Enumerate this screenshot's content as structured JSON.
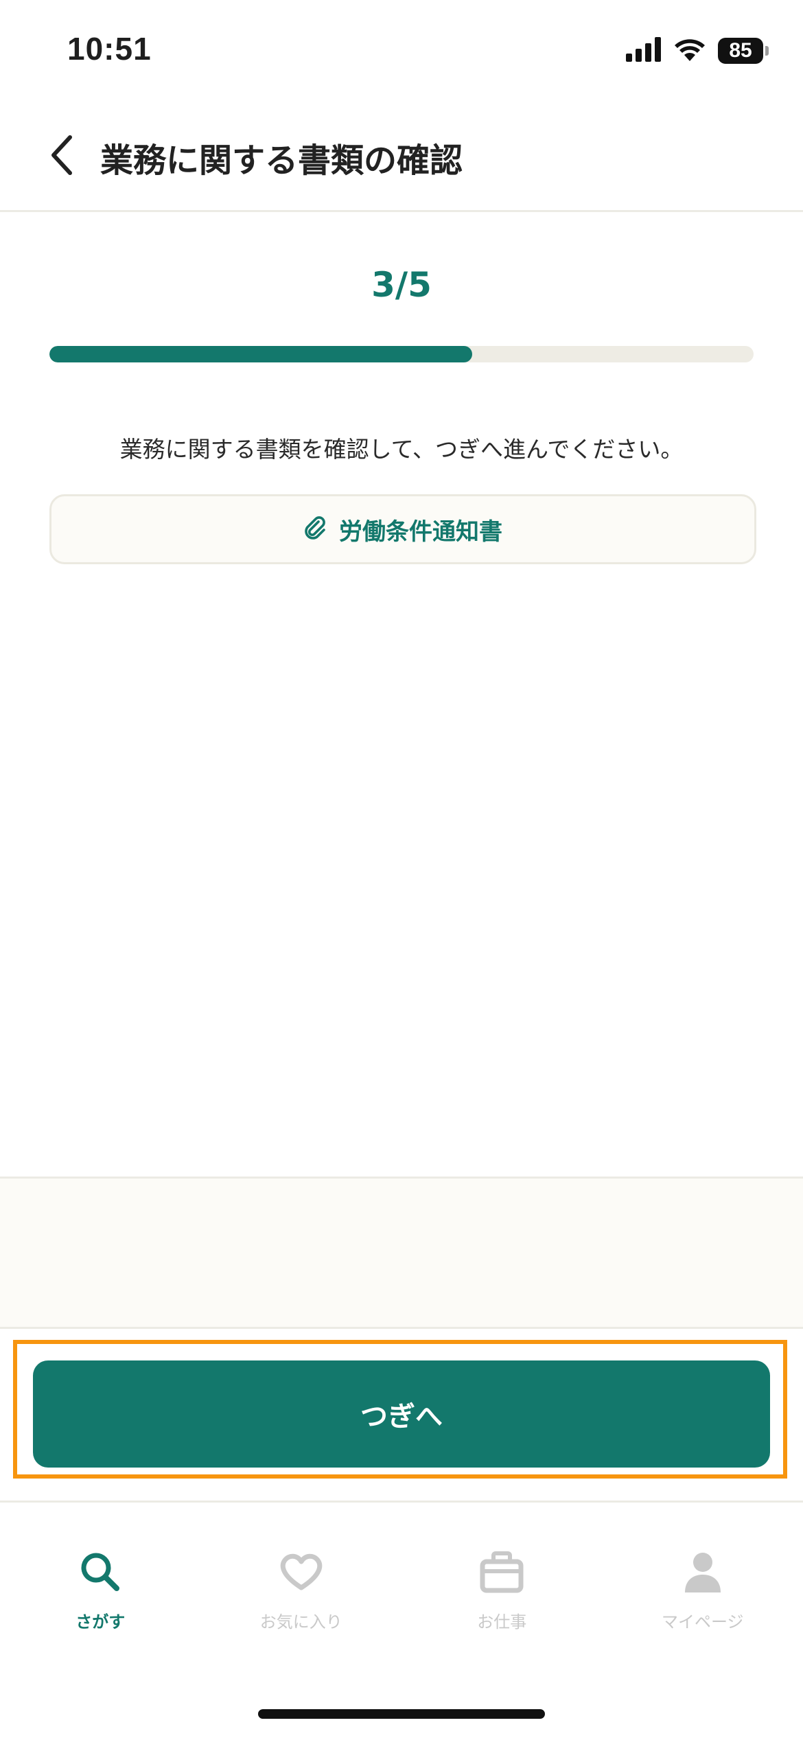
{
  "status_bar": {
    "time": "10:51",
    "battery": "85"
  },
  "header": {
    "title": "業務に関する書類の確認"
  },
  "progress": {
    "step_text": "3/5",
    "fraction": 0.6
  },
  "content": {
    "instruction": "業務に関する書類を確認して、つぎへ進んでください。",
    "document_link_label": "労働条件通知書",
    "document_icon": "paperclip-icon"
  },
  "actions": {
    "next_label": "つぎへ"
  },
  "tab_bar": {
    "items": [
      {
        "label": "さがす",
        "icon": "search-icon",
        "active": true
      },
      {
        "label": "お気に入り",
        "icon": "heart-icon",
        "active": false
      },
      {
        "label": "お仕事",
        "icon": "briefcase-icon",
        "active": false
      },
      {
        "label": "マイページ",
        "icon": "person-icon",
        "active": false
      }
    ]
  },
  "colors": {
    "brand": "#13786c",
    "highlight": "#f7950f",
    "track": "#eeece4",
    "inactive_tab": "#c9c9c9"
  }
}
